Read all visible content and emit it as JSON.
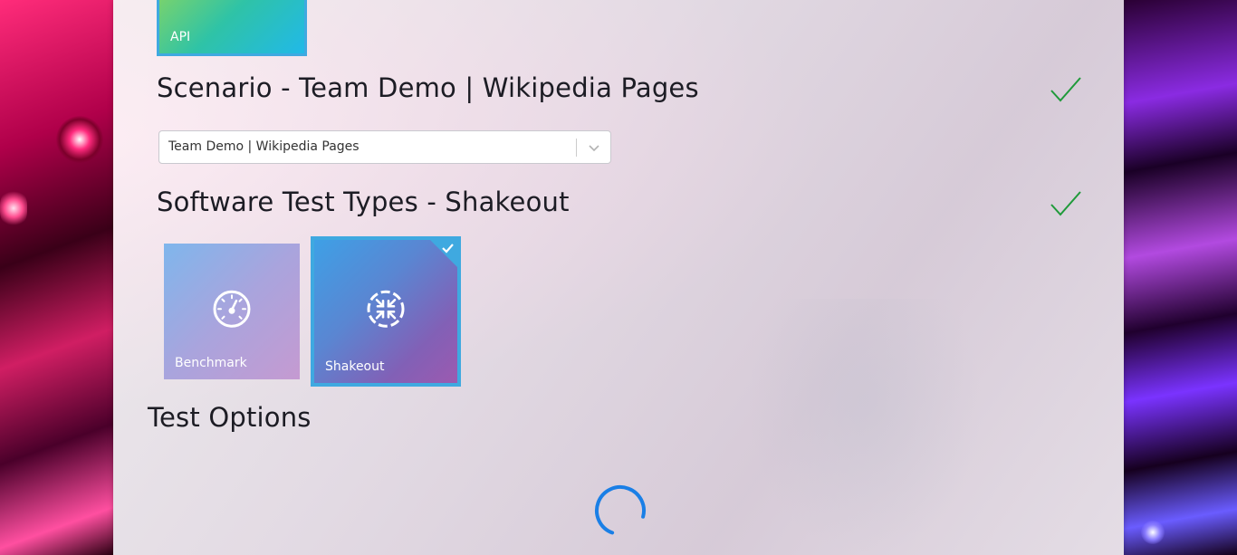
{
  "scenario": {
    "title": "Scenario - Team Demo | Wikipedia Pages",
    "select_value": "Team Demo | Wikipedia Pages",
    "status_icon": "checkmark-icon"
  },
  "api_tile": {
    "label": "API"
  },
  "test_types": {
    "title": "Software Test Types - Shakeout",
    "status_icon": "checkmark-icon",
    "options": [
      {
        "label": "Benchmark",
        "icon": "speedometer-icon",
        "selected": false
      },
      {
        "label": "Shakeout",
        "icon": "arrows-inward-icon",
        "selected": true
      }
    ]
  },
  "test_options": {
    "title": "Test Options",
    "loading_icon": "spinner-icon"
  },
  "colors": {
    "accent": "#3fa9e0",
    "check": "#1f9a3a",
    "spinner": "#1a7fe6"
  }
}
